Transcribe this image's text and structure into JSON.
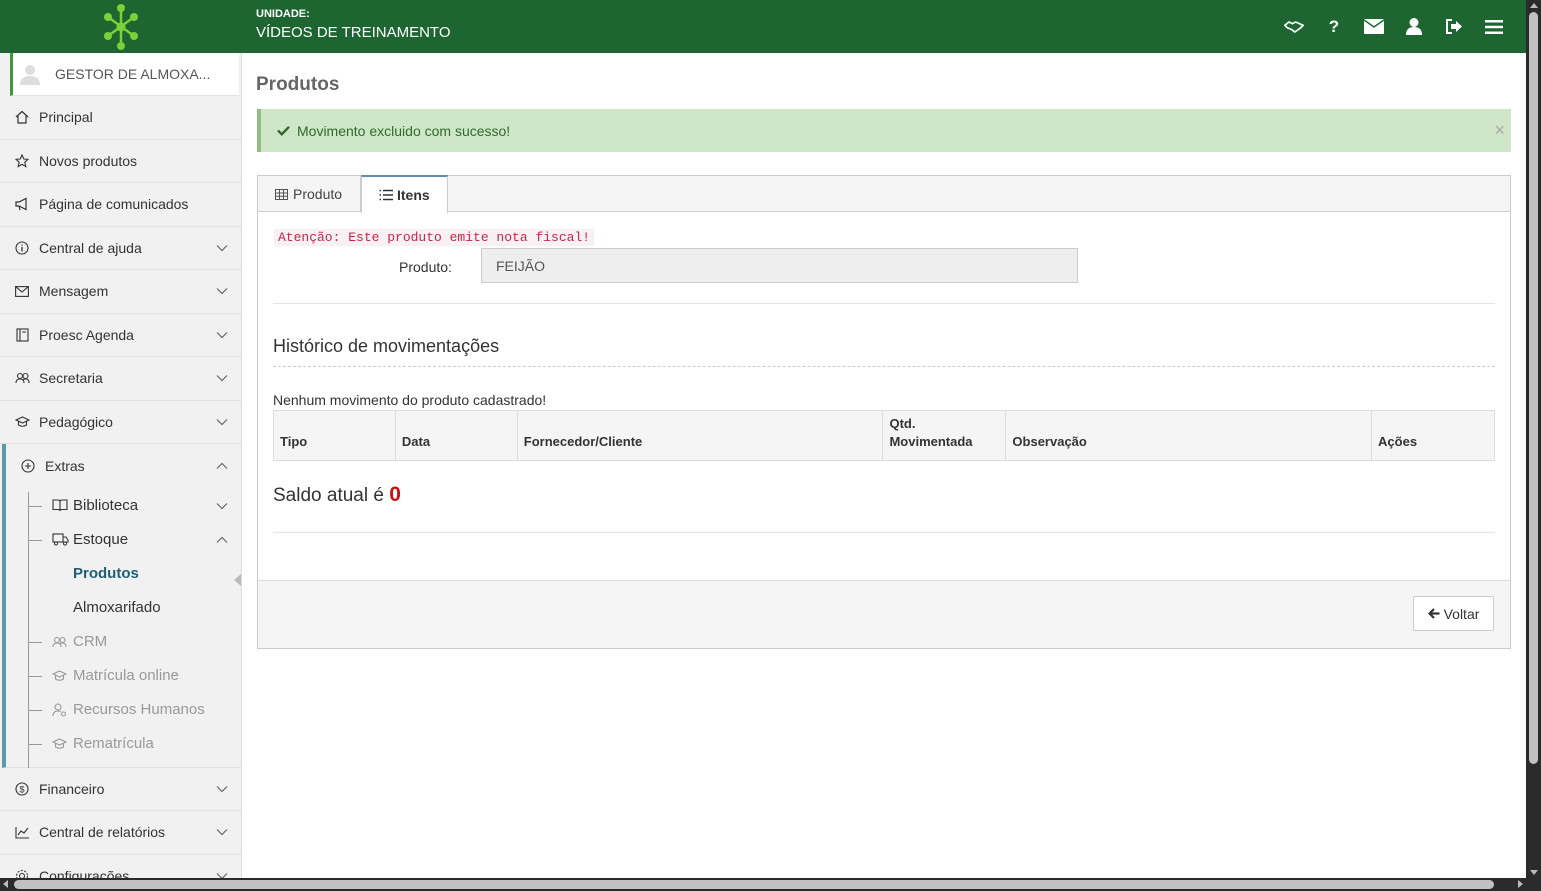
{
  "header": {
    "unit_label": "UNIDADE:",
    "unit_value": "VÍDEOS DE TREINAMENTO",
    "icons": [
      "handshake-icon",
      "help-icon",
      "envelope-icon",
      "user-icon",
      "logout-icon",
      "menu-icon"
    ],
    "brand_color": "#1e6631"
  },
  "sidebar": {
    "user": "GESTOR DE ALMOXA...",
    "items": [
      {
        "label": "Principal",
        "icon": "home-icon"
      },
      {
        "label": "Novos produtos",
        "icon": "star-icon"
      },
      {
        "label": "Página de comunicados",
        "icon": "megaphone-icon"
      },
      {
        "label": "Central de ajuda",
        "icon": "info-icon"
      },
      {
        "label": "Mensagem",
        "icon": "envelope-icon"
      },
      {
        "label": "Proesc Agenda",
        "icon": "agenda-icon"
      },
      {
        "label": "Secretaria",
        "icon": "users-icon"
      },
      {
        "label": "Pedagógico",
        "icon": "graduation-icon"
      },
      {
        "label": "Extras",
        "icon": "plus-circle-icon"
      },
      {
        "label": "Financeiro",
        "icon": "dollar-icon"
      },
      {
        "label": "Central de relatórios",
        "icon": "chart-icon"
      },
      {
        "label": "Configurações",
        "icon": "gear-icon"
      }
    ],
    "extras_sub": {
      "biblioteca": "Biblioteca",
      "estoque": "Estoque",
      "produtos": "Produtos",
      "almoxarifado": "Almoxarifado",
      "crm": "CRM",
      "matricula": "Matrícula online",
      "rh": "Recursos Humanos",
      "rematricula": "Rematrícula"
    }
  },
  "main": {
    "title": "Produtos",
    "alert": "Movimento excluido com sucesso!",
    "alert_close": "×",
    "tabs": [
      {
        "label": "Produto"
      },
      {
        "label": "Itens"
      }
    ],
    "warning": "Atenção: Este produto emite nota fiscal!",
    "produto_label": "Produto:",
    "produto_value": "FEIJÃO",
    "history_title": "Histórico de movimentações",
    "empty_message": "Nenhum movimento do produto cadastrado!",
    "table_headers": [
      "Tipo",
      "Data",
      "Fornecedor/Cliente",
      "Qtd. Movimentada",
      "Observação",
      "Ações"
    ],
    "saldo_label": "Saldo atual é",
    "saldo_value": "0",
    "back_button": "Voltar"
  }
}
